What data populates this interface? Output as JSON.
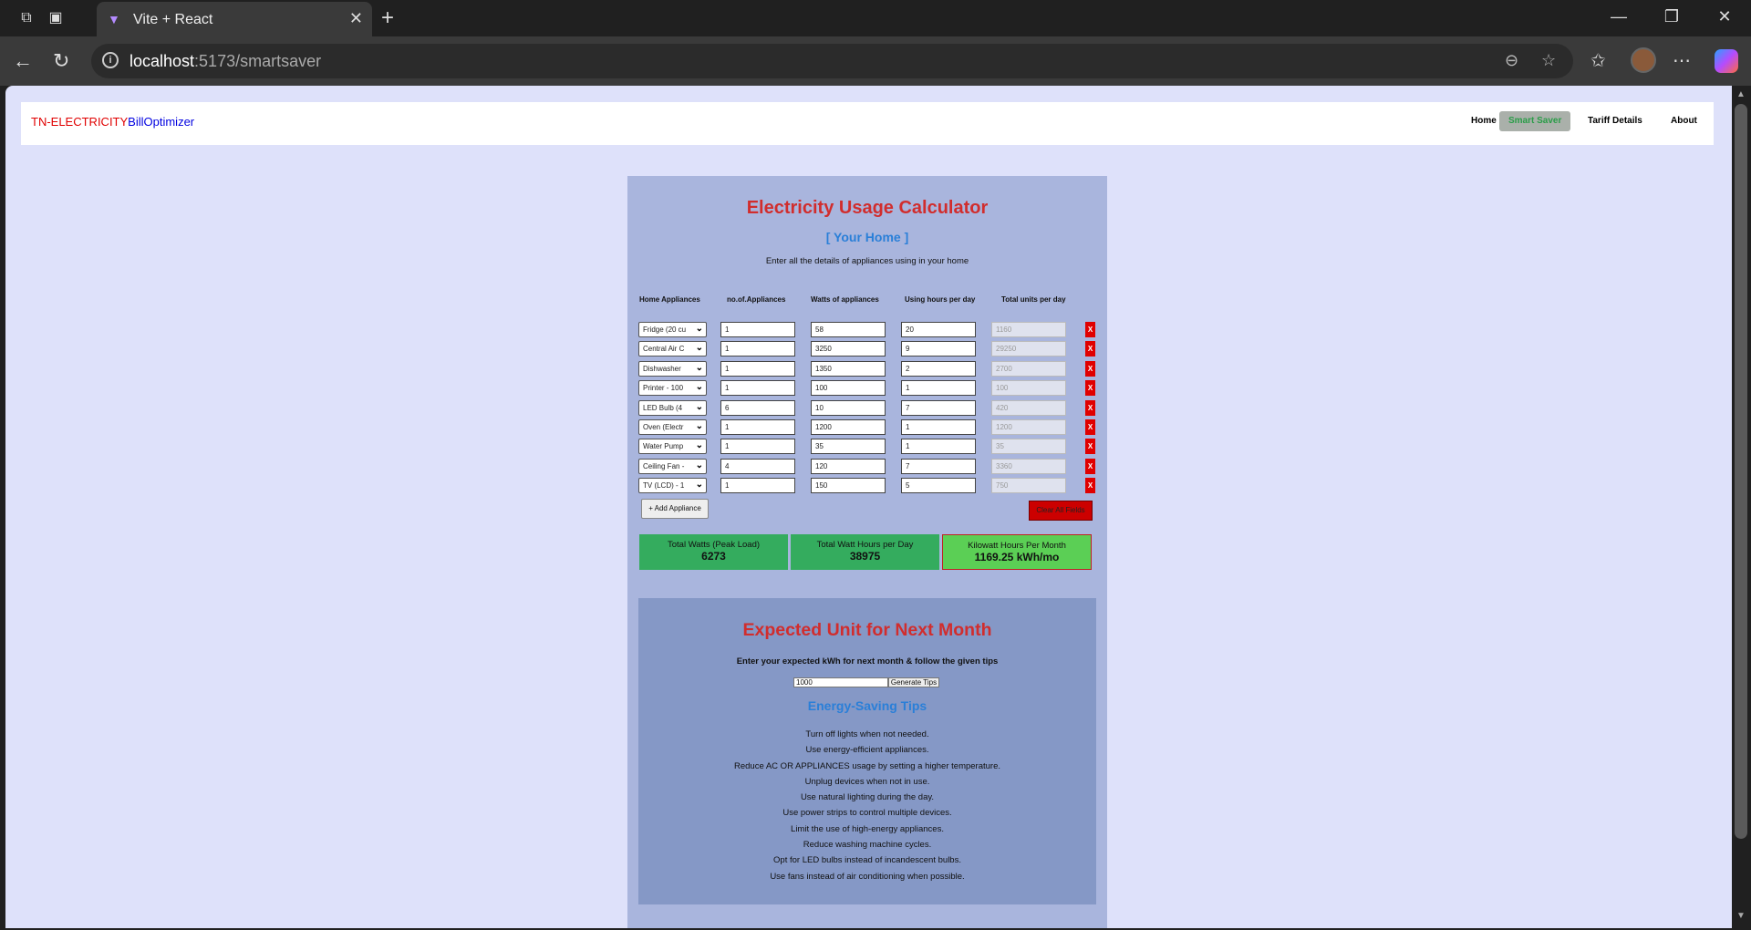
{
  "browser": {
    "tab_title": "Vite + React",
    "url_host": "localhost",
    "url_path": ":5173/smartsaver"
  },
  "navbar": {
    "brand_part1": "TN-ELECTRICITY",
    "brand_part2": "BillOptimizer",
    "links": [
      "Home",
      "Smart Saver",
      "Tariff Details",
      "About"
    ],
    "active": "Smart Saver"
  },
  "calculator": {
    "title": "Electricity Usage Calculator",
    "subtitle": "[ Your Home ]",
    "intro": "Enter all the details of appliances using in your home",
    "headers": [
      "Home Appliances",
      "no.of.Appliances",
      "Watts of appliances",
      "Using hours per day",
      "Total units per day"
    ],
    "rows": [
      {
        "appliance": "Fridge (20 cu",
        "count": "1",
        "watts": "58",
        "hours": "20",
        "total": "1160"
      },
      {
        "appliance": "Central Air C",
        "count": "1",
        "watts": "3250",
        "hours": "9",
        "total": "29250"
      },
      {
        "appliance": "Dishwasher",
        "count": "1",
        "watts": "1350",
        "hours": "2",
        "total": "2700"
      },
      {
        "appliance": "Printer - 100",
        "count": "1",
        "watts": "100",
        "hours": "1",
        "total": "100"
      },
      {
        "appliance": "LED Bulb (4",
        "count": "6",
        "watts": "10",
        "hours": "7",
        "total": "420"
      },
      {
        "appliance": "Oven (Electr",
        "count": "1",
        "watts": "1200",
        "hours": "1",
        "total": "1200"
      },
      {
        "appliance": "Water Pump",
        "count": "1",
        "watts": "35",
        "hours": "1",
        "total": "35"
      },
      {
        "appliance": "Ceiling Fan -",
        "count": "4",
        "watts": "120",
        "hours": "7",
        "total": "3360"
      },
      {
        "appliance": "TV (LCD) - 1",
        "count": "1",
        "watts": "150",
        "hours": "5",
        "total": "750"
      }
    ],
    "delete_label": "X",
    "add_label": "+ Add Appliance",
    "clear_label": "Clear All Fields",
    "stats": [
      {
        "label": "Total Watts (Peak Load)",
        "value": "6273"
      },
      {
        "label": "Total Watt Hours per Day",
        "value": "38975"
      },
      {
        "label": "Kilowatt Hours Per Month",
        "value": "1169.25 kWh/mo"
      }
    ]
  },
  "expected": {
    "title": "Expected Unit for Next Month",
    "subtitle": "Enter your expected kWh for next month & follow the given tips",
    "input_value": "1000",
    "button_label": "Generate Tips",
    "tips_title": "Energy-Saving Tips",
    "tips": [
      "Turn off lights when not needed.",
      "Use energy-efficient appliances.",
      "Reduce AC OR APPLIANCES usage by setting a higher temperature.",
      "Unplug devices when not in use.",
      "Use natural lighting during the day.",
      "Use power strips to control multiple devices.",
      "Limit the use of high-energy appliances.",
      "Reduce washing machine cycles.",
      "Opt for LED bulbs instead of incandescent bulbs.",
      "Use fans instead of air conditioning when possible."
    ]
  }
}
